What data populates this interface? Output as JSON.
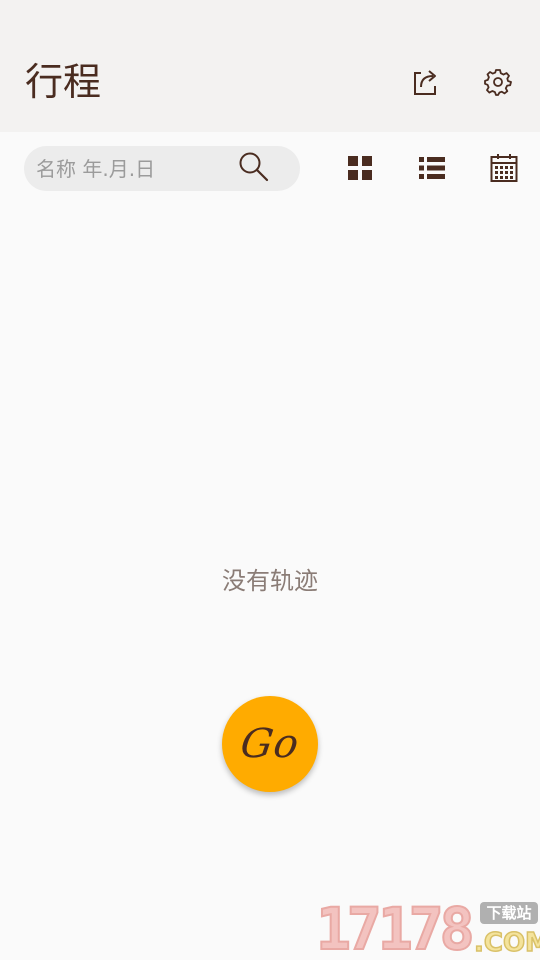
{
  "header": {
    "title": "行程",
    "share_icon": "share-export-icon",
    "settings_icon": "gear-icon",
    "background": "#f3f2f1",
    "title_color": "#4a2c20"
  },
  "toolbar": {
    "search": {
      "placeholder": "名称 年.月.日",
      "value": "",
      "icon": "search-icon"
    },
    "view_buttons": [
      {
        "name": "grid-view",
        "icon": "grid-icon"
      },
      {
        "name": "list-view",
        "icon": "list-icon"
      },
      {
        "name": "calendar-view",
        "icon": "calendar-icon"
      }
    ]
  },
  "main": {
    "empty_message": "没有轨迹"
  },
  "fab": {
    "label": "Go",
    "color": "#ffab00"
  },
  "watermark": {
    "number": "17178",
    "tag": "下载站",
    "domain": ".COM"
  }
}
